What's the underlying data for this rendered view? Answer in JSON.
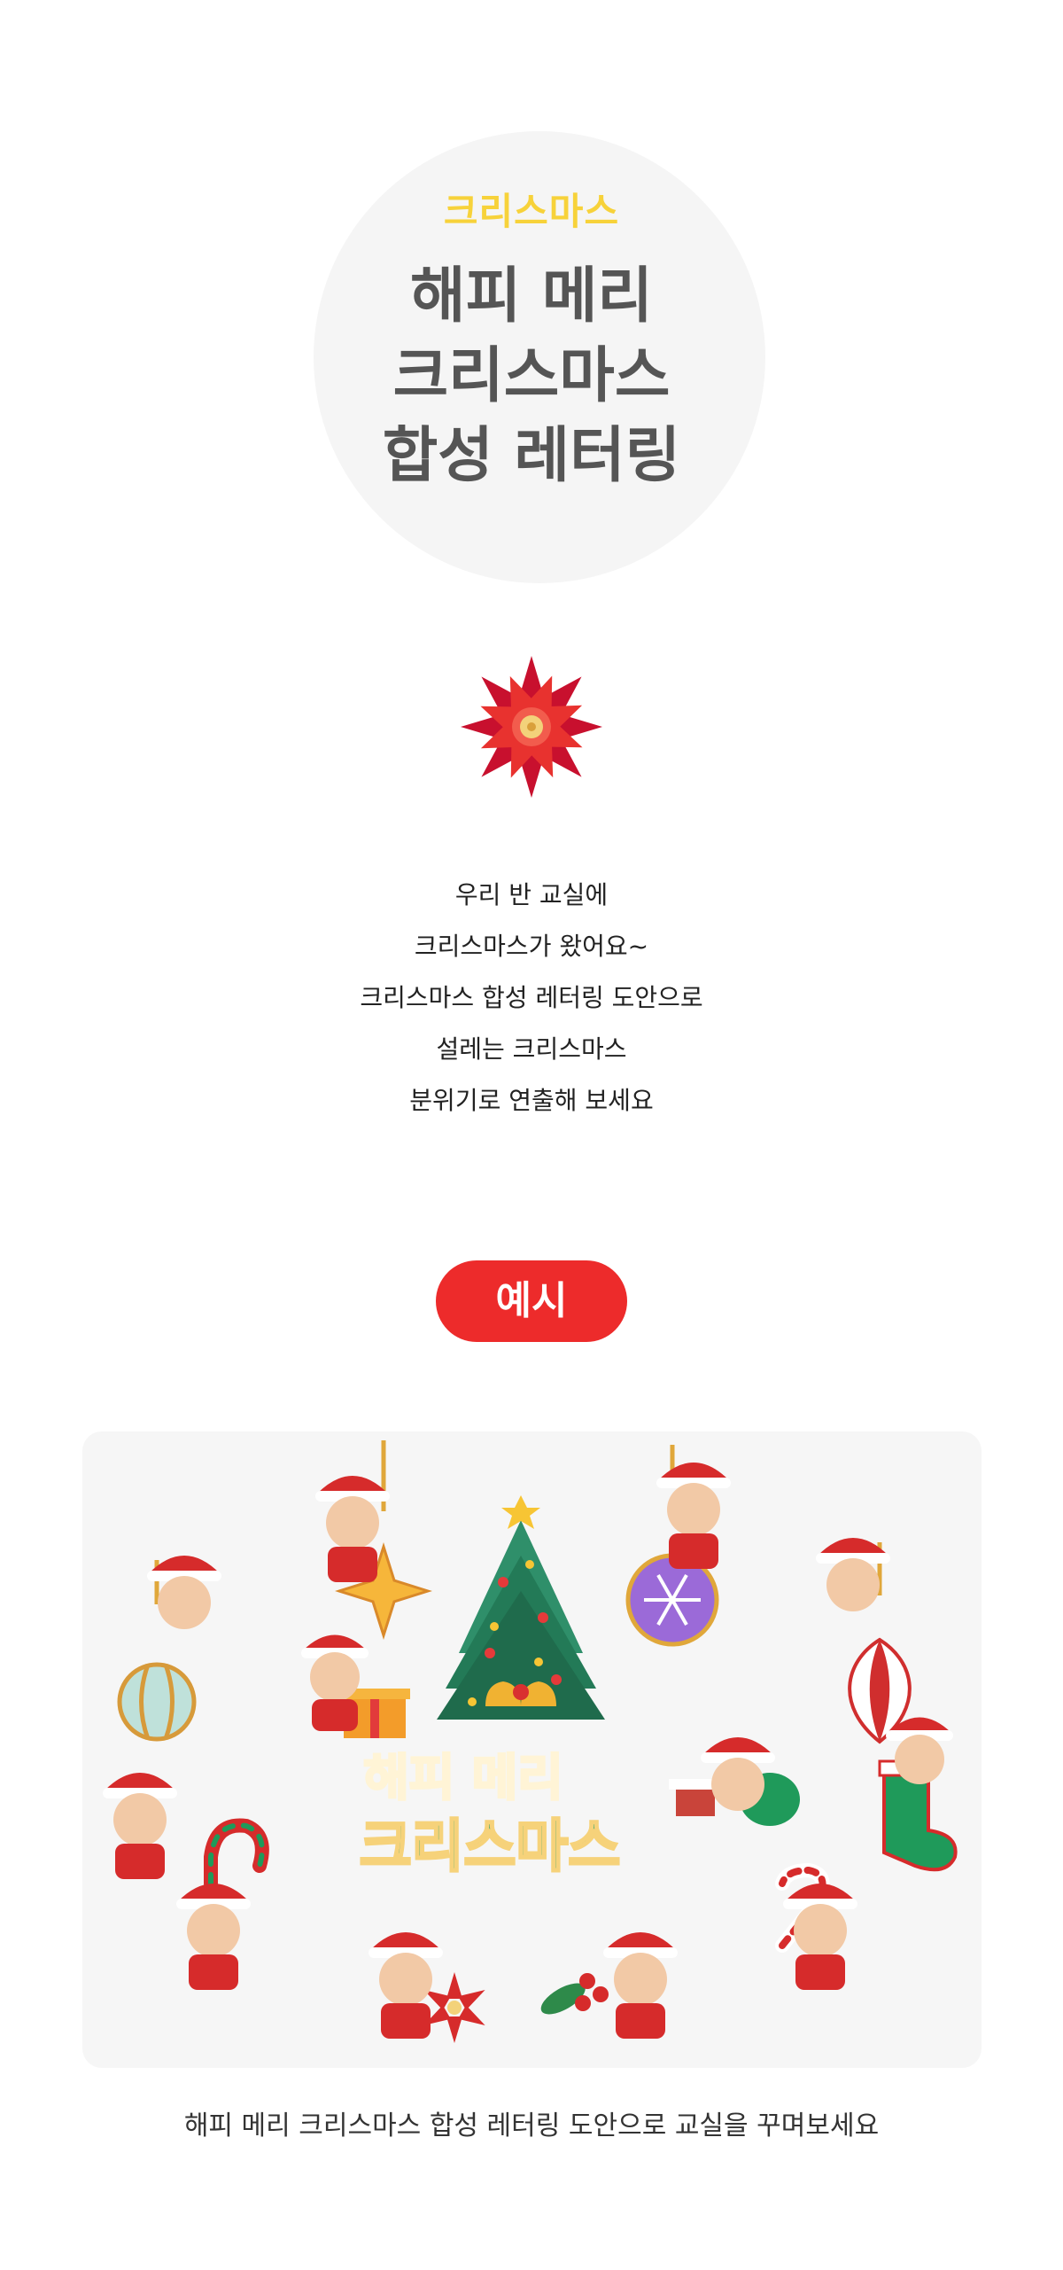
{
  "hero": {
    "eyebrow": "크리스마스",
    "title_lines": [
      "해피 메리",
      "크리스마스",
      "합성 레터링"
    ]
  },
  "description": {
    "lines": [
      "우리 반 교실에",
      "크리스마스가 왔어요~",
      "크리스마스 합성 레터링 도안으로",
      "설레는 크리스마스",
      "분위기로 연출해 보세요"
    ]
  },
  "example": {
    "badge": "예시",
    "lettering_top": "해피 메리",
    "lettering_bottom": "크리스마스",
    "caption": "해피 메리 크리스마스 합성 레터링 도안으로 교실을 꾸며보세요"
  },
  "colors": {
    "accent_red": "#ed2b2b",
    "eyebrow_yellow": "#f7d23a",
    "title_gray": "#555555",
    "card_bg": "#f6f6f6"
  }
}
